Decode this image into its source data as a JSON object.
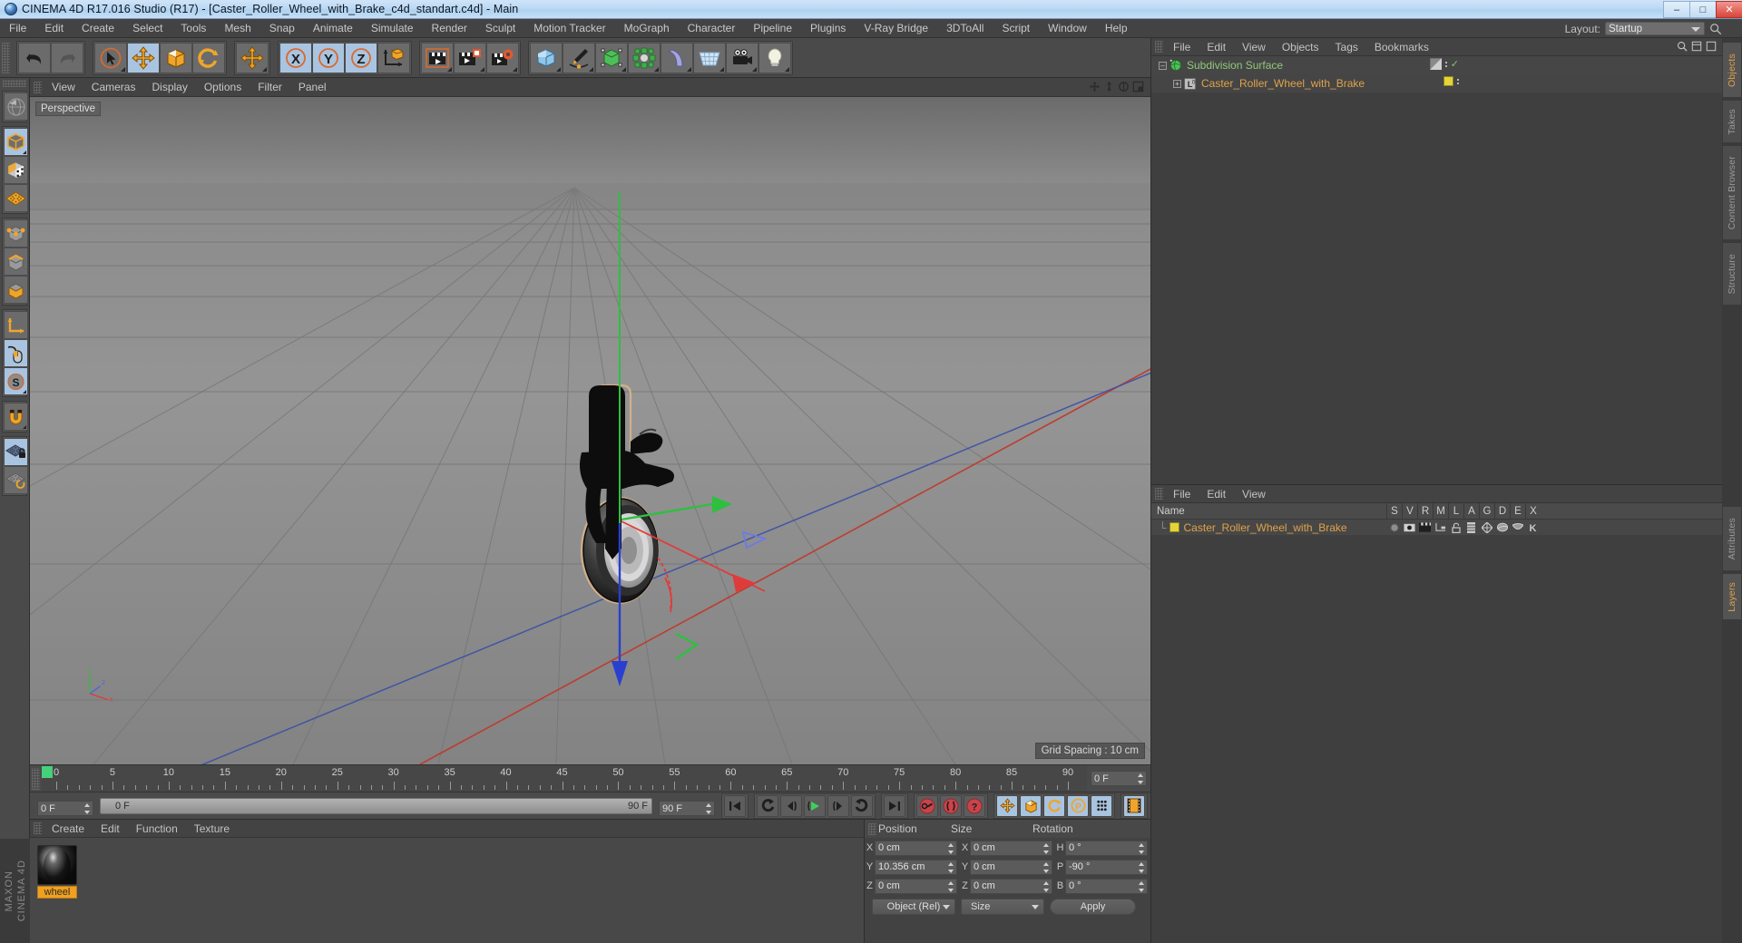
{
  "window": {
    "title": "CINEMA 4D R17.016 Studio (R17) - [Caster_Roller_Wheel_with_Brake_c4d_standart.c4d] - Main",
    "minimize": "–",
    "maximize": "□",
    "close": "✕"
  },
  "menubar": {
    "items": [
      "File",
      "Edit",
      "Create",
      "Select",
      "Tools",
      "Mesh",
      "Snap",
      "Animate",
      "Simulate",
      "Render",
      "Sculpt",
      "Motion Tracker",
      "MoGraph",
      "Character",
      "Pipeline",
      "Plugins",
      "V-Ray Bridge",
      "3DToAll",
      "Script",
      "Window",
      "Help"
    ],
    "layout_label": "Layout:",
    "layout_value": "Startup"
  },
  "viewport": {
    "menu": [
      "View",
      "Cameras",
      "Display",
      "Options",
      "Filter",
      "Panel"
    ],
    "label": "Perspective",
    "grid_spacing": "Grid Spacing : 10 cm",
    "axis_labels": {
      "x": "X",
      "y": "Y",
      "z": "Z"
    }
  },
  "timeline": {
    "ticks": [
      0,
      5,
      10,
      15,
      20,
      25,
      30,
      35,
      40,
      45,
      50,
      55,
      60,
      65,
      70,
      75,
      80,
      85,
      90
    ],
    "current_frame": "0 F",
    "range_start": "0 F",
    "range_end": "90 F",
    "end_frame_field": "90 F",
    "preview_end": "90 F",
    "right_frame_field": "0 F"
  },
  "material_manager": {
    "menu": [
      "Create",
      "Edit",
      "Function",
      "Texture"
    ],
    "materials": [
      {
        "name": "wheel"
      }
    ]
  },
  "coordinates": {
    "headers": [
      "Position",
      "Size",
      "Rotation"
    ],
    "position": {
      "labels": [
        "X",
        "Y",
        "Z"
      ],
      "values": [
        "0 cm",
        "10.356 cm",
        "0 cm"
      ]
    },
    "size": {
      "labels": [
        "X",
        "Y",
        "Z"
      ],
      "values": [
        "0 cm",
        "0 cm",
        "0 cm"
      ]
    },
    "rotation": {
      "labels": [
        "H",
        "P",
        "B"
      ],
      "values": [
        "0 °",
        "-90 °",
        "0 °"
      ]
    },
    "mode_dropdown": "Object (Rel)",
    "size_dropdown": "Size",
    "apply_button": "Apply"
  },
  "object_manager": {
    "menu": [
      "File",
      "Edit",
      "View",
      "Objects",
      "Tags",
      "Bookmarks"
    ],
    "rows": [
      {
        "name": "Subdivision Surface",
        "type": "generator",
        "tag": "check"
      },
      {
        "name": "Caster_Roller_Wheel_with_Brake",
        "type": "object",
        "tag": "yellow",
        "level_badge": "0"
      }
    ]
  },
  "layer_manager": {
    "menu": [
      "File",
      "Edit",
      "View"
    ],
    "columns": [
      "Name",
      "S",
      "V",
      "R",
      "M",
      "L",
      "A",
      "G",
      "D",
      "E",
      "X"
    ],
    "rows": [
      {
        "name": "Caster_Roller_Wheel_with_Brake"
      }
    ]
  },
  "right_tabs": {
    "top": [
      "Objects",
      "Takes",
      "Content Browser",
      "Structure"
    ],
    "bottom": [
      "Attributes",
      "Layers"
    ],
    "active_top": "Objects",
    "active_bottom": "Layers"
  },
  "brand": {
    "line1": "MAXON",
    "line2": "CINEMA 4D"
  },
  "colors": {
    "accent_orange": "#e0a24a",
    "selection_blue": "#a9c4e0",
    "green_axis": "#3ecf5a",
    "red_axis": "#e03b3b",
    "blue_axis": "#3b4fe0",
    "material_name_bg": "#f0a020",
    "titlebar": "#bcd9f4",
    "panel_bg": "#424242"
  }
}
